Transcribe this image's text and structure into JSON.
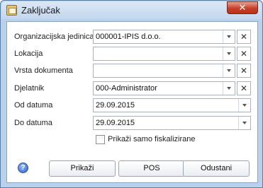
{
  "window": {
    "title": "Zaključak",
    "close_glyph": "✕"
  },
  "form": {
    "fields": [
      {
        "label": "Organizacijska jedinica",
        "value": "000001-IPIS d.o.o."
      },
      {
        "label": "Lokacija",
        "value": ""
      },
      {
        "label": "Vrsta dokumenta",
        "value": ""
      },
      {
        "label": "Djelatnik",
        "value": "000-Administrator"
      },
      {
        "label": "Od datuma",
        "value": "29.09.2015"
      },
      {
        "label": "Do datuma",
        "value": "29.09.2015"
      }
    ],
    "clear_glyph": "✕",
    "checkbox": {
      "label": "Prikaži samo fiskalizirane",
      "checked": false
    }
  },
  "footer": {
    "help_glyph": "?",
    "buttons": {
      "show": "Prikaži",
      "pos": "POS",
      "cancel": "Odustani"
    }
  }
}
